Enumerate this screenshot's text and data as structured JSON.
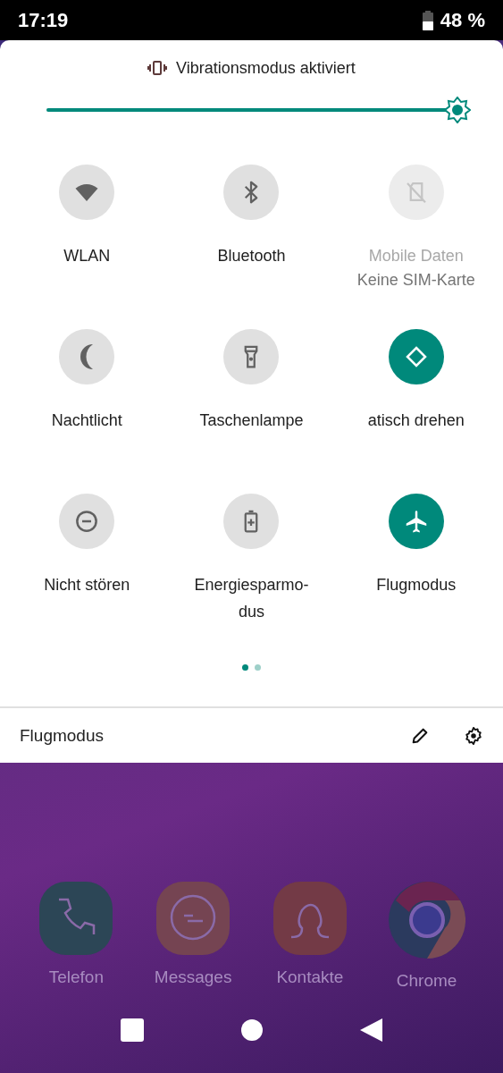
{
  "status_bar": {
    "time": "17:19",
    "battery": "48 %"
  },
  "header": {
    "text": "Vibrationsmodus aktiviert"
  },
  "brightness": {
    "level": 1
  },
  "tiles": [
    {
      "label": "WLAN",
      "on": false,
      "disabled": false
    },
    {
      "label": "Bluetooth",
      "on": false,
      "disabled": false
    },
    {
      "label": "Mobile Daten",
      "sublabel": "Keine SIM-Karte",
      "on": false,
      "disabled": true
    },
    {
      "label": "Nachtlicht",
      "on": false,
      "disabled": false
    },
    {
      "label": "Taschenlampe",
      "on": false,
      "disabled": false
    },
    {
      "label": "atisch drehen",
      "on": true,
      "disabled": false
    },
    {
      "label": "Nicht stören",
      "on": false,
      "disabled": false
    },
    {
      "label": "Energiesparmo-\ndus",
      "on": false,
      "disabled": false
    },
    {
      "label": "Flugmodus",
      "on": true,
      "disabled": false
    }
  ],
  "pages": [
    {
      "selected": true
    },
    {
      "selected": false
    }
  ],
  "footer": {
    "text": "Flugmodus"
  },
  "apps": [
    {
      "label": "Telefon"
    },
    {
      "label": "Messages"
    },
    {
      "label": "Kontakte"
    },
    {
      "label": "Chrome"
    }
  ]
}
